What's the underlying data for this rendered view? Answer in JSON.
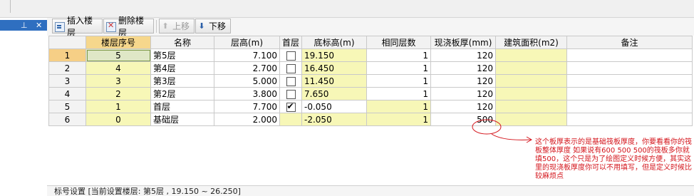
{
  "left_panel": {
    "pin_icon": "pin-icon",
    "close_glyph": "✕"
  },
  "toolbar": {
    "insert_label": "插入楼层",
    "delete_label": "删除楼层",
    "up_label": "上移",
    "down_label": "下移"
  },
  "table": {
    "headers": [
      "",
      "楼层序号",
      "名称",
      "层高(m)",
      "首层",
      "底标高(m)",
      "相同层数",
      "现浇板厚(mm)",
      "建筑面积(m2)",
      "备注"
    ],
    "rows": [
      {
        "rownum": "1",
        "seq": "5",
        "name": "第5层",
        "height": "7.100",
        "first": false,
        "base": "19.150",
        "same": "1",
        "slab": "120",
        "area": "",
        "note": ""
      },
      {
        "rownum": "2",
        "seq": "4",
        "name": "第4层",
        "height": "2.700",
        "first": false,
        "base": "16.450",
        "same": "1",
        "slab": "120",
        "area": "",
        "note": ""
      },
      {
        "rownum": "3",
        "seq": "3",
        "name": "第3层",
        "height": "5.000",
        "first": false,
        "base": "11.450",
        "same": "1",
        "slab": "120",
        "area": "",
        "note": ""
      },
      {
        "rownum": "4",
        "seq": "2",
        "name": "第2层",
        "height": "3.800",
        "first": false,
        "base": "7.650",
        "same": "1",
        "slab": "120",
        "area": "",
        "note": ""
      },
      {
        "rownum": "5",
        "seq": "1",
        "name": "首层",
        "height": "7.700",
        "first": true,
        "base": "-0.050",
        "same": "1",
        "slab": "120",
        "area": "",
        "note": ""
      },
      {
        "rownum": "6",
        "seq": "0",
        "name": "基础层",
        "height": "2.000",
        "first": false,
        "base": "-2.050",
        "same": "1",
        "slab": "500",
        "area": "",
        "note": ""
      }
    ]
  },
  "bottom_bar": {
    "text": "标号设置 [当前设置楼层: 第5层 , 19.150 ~ 26.250]"
  },
  "annotation": {
    "text": "这个板厚表示的是基础筏板厚度，你要看看你的筏板整体厚度 如果说有600  500 500的筏板多你就填500，这个只是为了绘图定义时候方便，其实这里的现浇板厚度你可以不用填写，但是定义时候比较麻烦点",
    "color": "#d4141b"
  },
  "colors": {
    "selected_row": "#f6cf86",
    "yellow_cell": "#f7f7b7",
    "title_bar": "#2f6fc0"
  }
}
